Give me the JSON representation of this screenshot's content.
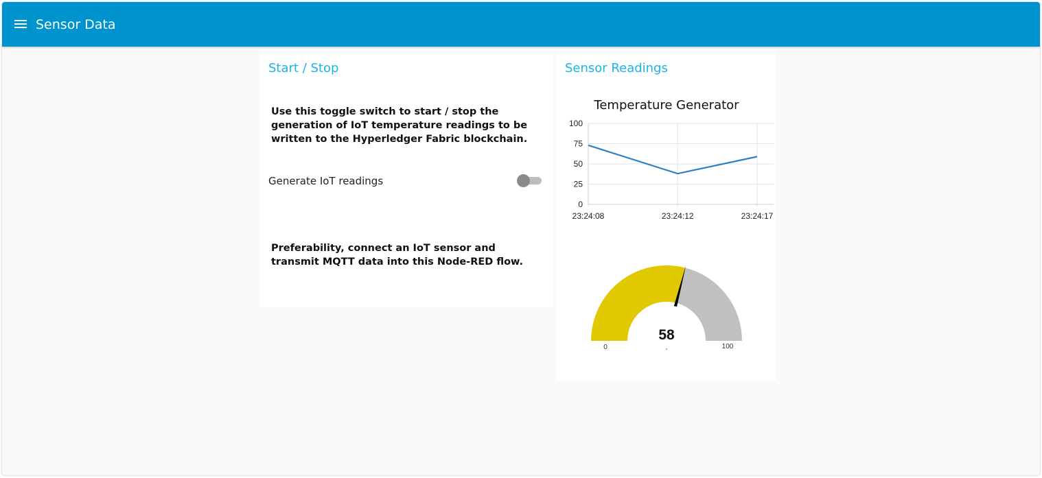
{
  "app": {
    "title": "Sensor Data",
    "menu_icon": "hamburger-menu-icon",
    "header_color": "#0094ce"
  },
  "control_card": {
    "title": "Start / Stop",
    "instructions": "Use this toggle switch to start / stop the generation of IoT temperature readings to be written to the Hyperledger Fabric blockchain.",
    "switch_label": "Generate IoT readings",
    "switch_on": false,
    "footer_text": "Preferability, connect an IoT sensor and transmit MQTT data into this Node-RED flow."
  },
  "readings_card": {
    "title": "Sensor Readings"
  },
  "chart_data": [
    {
      "type": "line",
      "title": "Temperature Generator",
      "x": [
        "23:24:08",
        "23:24:12",
        "23:24:17"
      ],
      "x_seconds": [
        0,
        4.5,
        8.5
      ],
      "xtick_labels": [
        "23:24:08",
        "23:24:12",
        "23:24:17"
      ],
      "series": [
        {
          "values": [
            73,
            38,
            59
          ],
          "color": "#2f7fc1"
        }
      ],
      "yticks": [
        0,
        25,
        50,
        75,
        100
      ],
      "ylim": [
        0,
        100
      ],
      "grid": true
    },
    {
      "type": "gauge",
      "value": 58,
      "min_label": "0",
      "max_label": "100",
      "units": ",",
      "min": 0,
      "max": 100,
      "fill_color": "#e0c900",
      "track_color": "#c0c0c0",
      "needle_color": "#000000"
    }
  ]
}
